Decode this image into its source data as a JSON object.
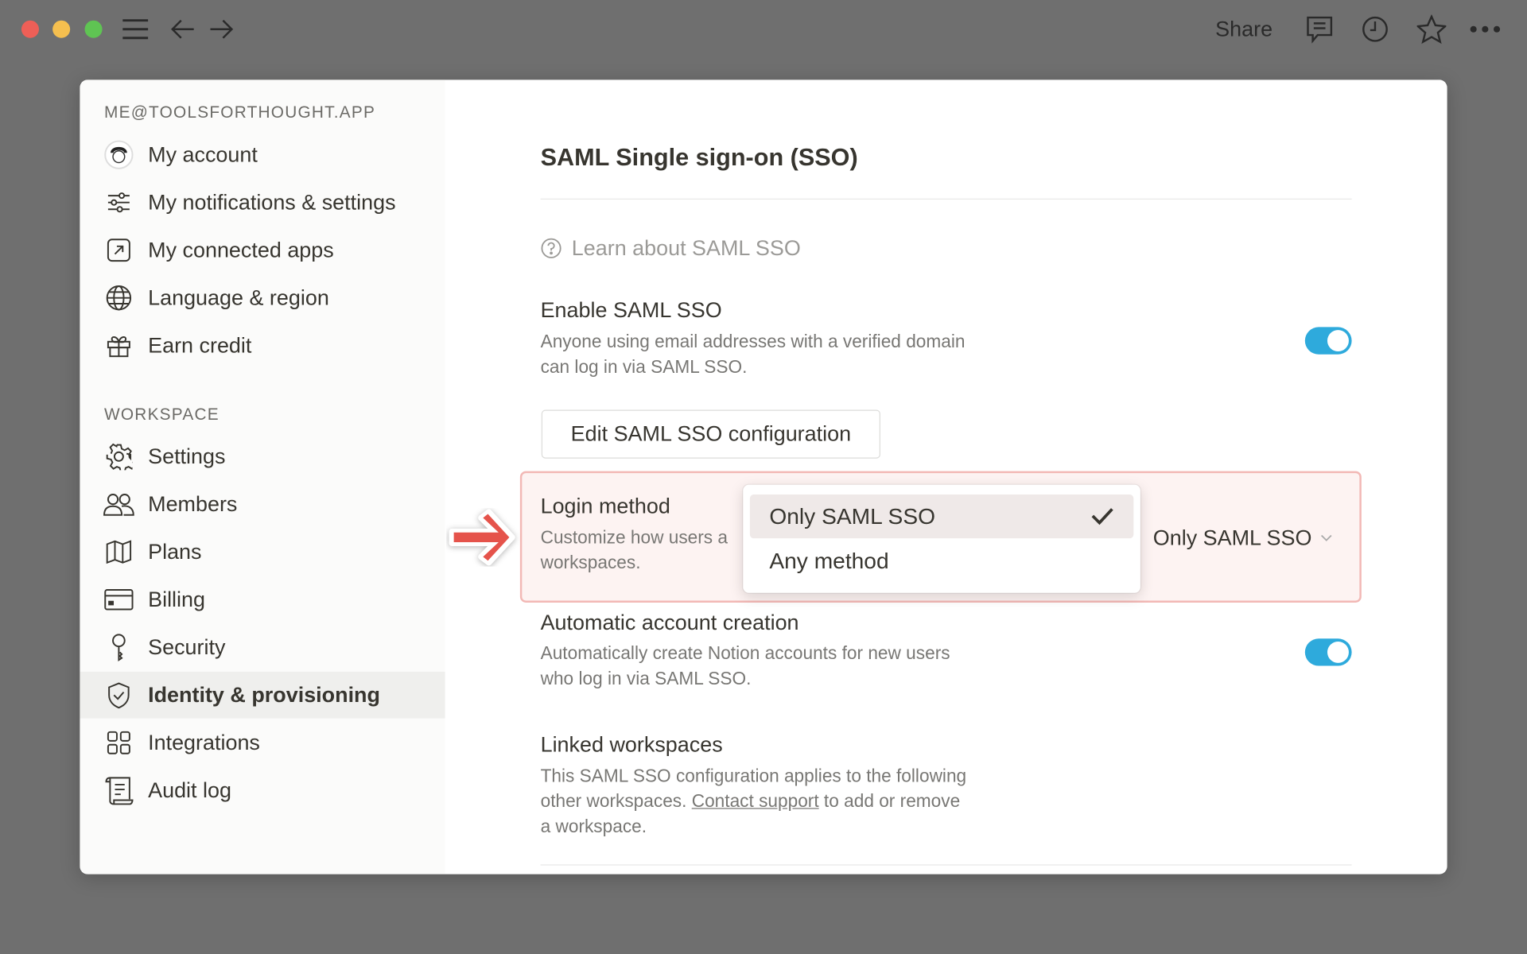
{
  "titlebar": {
    "share_label": "Share",
    "icons": [
      "menu-icon",
      "back-arrow-icon",
      "forward-arrow-icon",
      "comment-icon",
      "clock-icon",
      "star-icon",
      "more-icon"
    ]
  },
  "sidebar": {
    "account_label": "ME@TOOLSFORTHOUGHT.APP",
    "account_items": [
      {
        "label": "My account",
        "icon": "avatar"
      },
      {
        "label": "My notifications & settings",
        "icon": "sliders-icon"
      },
      {
        "label": "My connected apps",
        "icon": "external-link-icon"
      },
      {
        "label": "Language & region",
        "icon": "globe-icon"
      },
      {
        "label": "Earn credit",
        "icon": "gift-icon"
      }
    ],
    "workspace_label": "WORKSPACE",
    "workspace_items": [
      {
        "label": "Settings",
        "icon": "gear-icon"
      },
      {
        "label": "Members",
        "icon": "people-icon"
      },
      {
        "label": "Plans",
        "icon": "map-icon"
      },
      {
        "label": "Billing",
        "icon": "credit-card-icon"
      },
      {
        "label": "Security",
        "icon": "key-icon"
      },
      {
        "label": "Identity & provisioning",
        "icon": "shield-icon",
        "selected": true
      },
      {
        "label": "Integrations",
        "icon": "grid-icon"
      },
      {
        "label": "Audit log",
        "icon": "scroll-icon"
      }
    ]
  },
  "main": {
    "title": "SAML Single sign-on (SSO)",
    "learn_link": "Learn about SAML SSO",
    "enable": {
      "title": "Enable SAML SSO",
      "desc1": "Anyone using email addresses with a verified domain",
      "desc2": "can log in via SAML SSO.",
      "on": true
    },
    "edit_button": "Edit SAML SSO configuration",
    "login": {
      "title": "Login method",
      "desc1": "Customize how users a",
      "desc2": "workspaces.",
      "value": "Only SAML SSO",
      "options": [
        {
          "label": "Only SAML SSO",
          "selected": true
        },
        {
          "label": "Any method",
          "selected": false
        }
      ]
    },
    "auto": {
      "title": "Automatic account creation",
      "desc1": "Automatically create Notion accounts for new users",
      "desc2": "who log in via SAML SSO.",
      "on": true
    },
    "linked": {
      "title": "Linked workspaces",
      "desc1": "This SAML SSO configuration applies to the following",
      "desc2_pre": "other workspaces. ",
      "link": "Contact support",
      "desc2_post": " to add or remove",
      "desc3": "a workspace."
    }
  },
  "colors": {
    "toggle_on": "#2eaadc",
    "highlight_border": "#f2b8b5",
    "highlight_bg": "#fdf3f2",
    "arrow": "#e5534b"
  }
}
